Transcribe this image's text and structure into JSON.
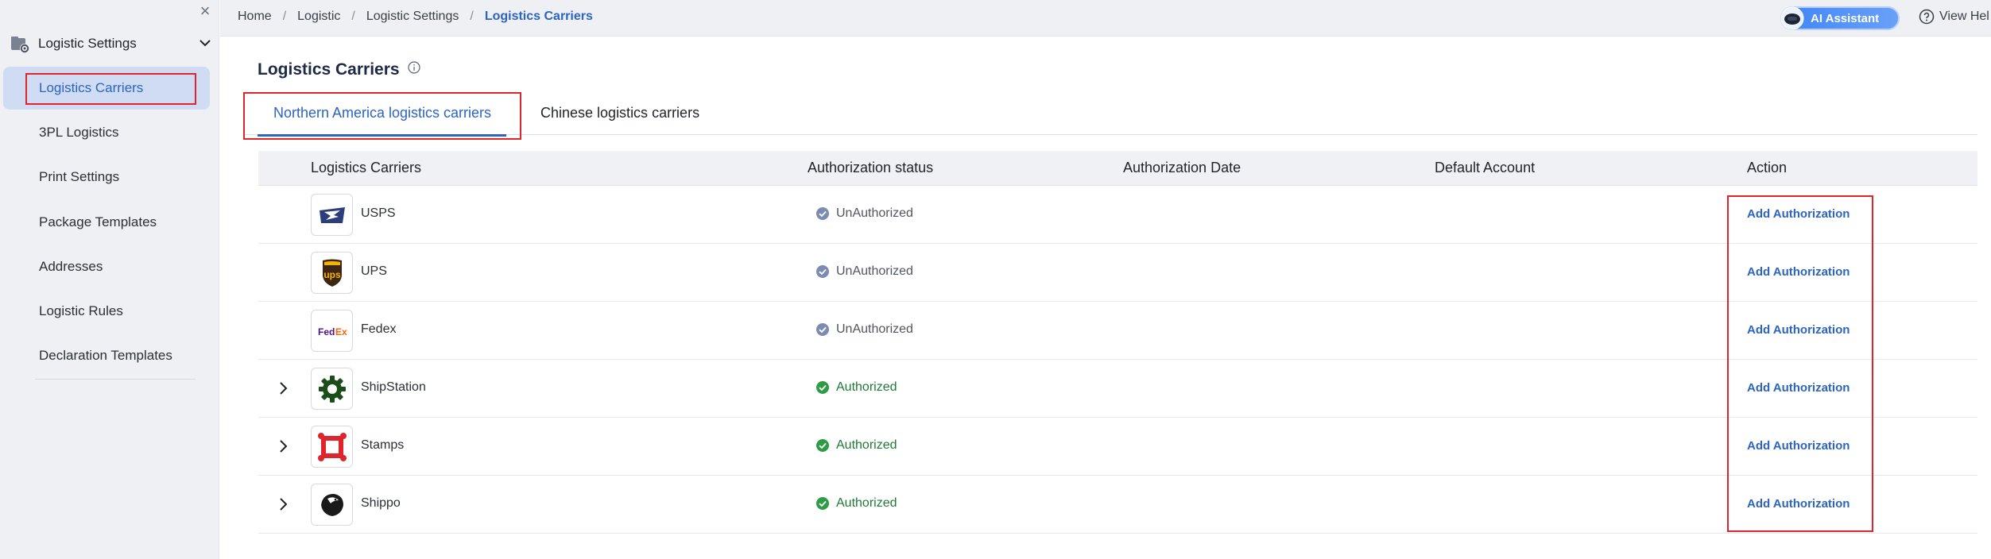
{
  "sidebar": {
    "section_title": "Logistic Settings",
    "items": [
      {
        "label": "Logistics Carriers",
        "active": true
      },
      {
        "label": "3PL Logistics"
      },
      {
        "label": "Print Settings"
      },
      {
        "label": "Package Templates"
      },
      {
        "label": "Addresses"
      },
      {
        "label": "Logistic Rules"
      },
      {
        "label": "Declaration Templates"
      }
    ]
  },
  "breadcrumb": [
    "Home",
    "Logistic",
    "Logistic Settings",
    "Logistics Carriers"
  ],
  "topbar": {
    "ai_label": "AI Assistant",
    "help_label": "View Hel"
  },
  "page": {
    "title": "Logistics Carriers",
    "tabs": [
      {
        "label": "Northern America logistics carriers",
        "active": true
      },
      {
        "label": "Chinese logistics carriers"
      }
    ]
  },
  "table": {
    "headers": [
      "Logistics Carriers",
      "Authorization status",
      "Authorization Date",
      "Default Account",
      "Action"
    ],
    "rows": [
      {
        "carrier": "USPS",
        "status": "UnAuthorized",
        "action": "Add Authorization",
        "expandable": false,
        "logo": "usps-eagle-icon"
      },
      {
        "carrier": "UPS",
        "status": "UnAuthorized",
        "action": "Add Authorization",
        "expandable": false,
        "logo": "ups-shield-icon"
      },
      {
        "carrier": "Fedex",
        "status": "UnAuthorized",
        "action": "Add Authorization",
        "expandable": false,
        "logo": "fedex-wordmark-icon"
      },
      {
        "carrier": "ShipStation",
        "status": "Authorized",
        "action": "Add Authorization",
        "expandable": true,
        "logo": "shipstation-gear-icon"
      },
      {
        "carrier": "Stamps",
        "status": "Authorized",
        "action": "Add Authorization",
        "expandable": true,
        "logo": "stamps-frame-icon"
      },
      {
        "carrier": "Shippo",
        "status": "Authorized",
        "action": "Add Authorization",
        "expandable": true,
        "logo": "shippo-penguin-icon"
      }
    ]
  },
  "colors": {
    "accent": "#2c64c0",
    "highlight_box": "#e0242b",
    "authorized": "#2e9b46",
    "unauthorized": "#7b8bb1"
  }
}
